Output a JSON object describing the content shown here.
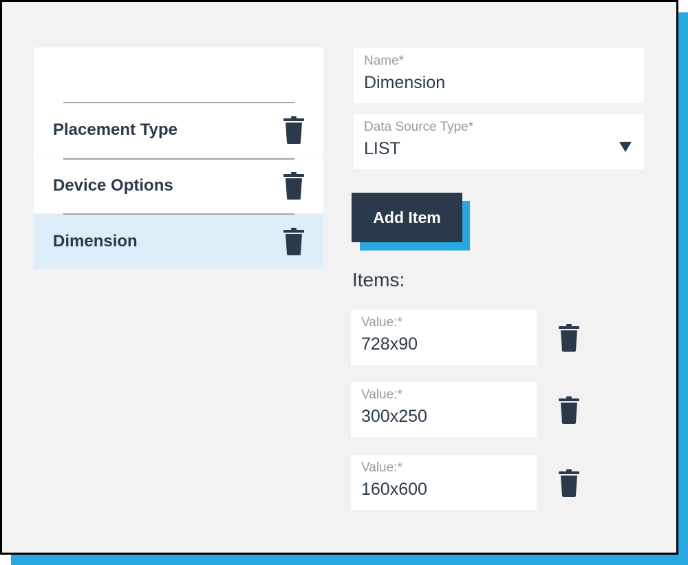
{
  "list": {
    "items": [
      {
        "label": "Placement Type",
        "selected": false
      },
      {
        "label": "Device Options",
        "selected": false
      },
      {
        "label": "Dimension",
        "selected": true
      }
    ]
  },
  "form": {
    "name": {
      "label": "Name*",
      "value": "Dimension"
    },
    "data_source_type": {
      "label": "Data Source Type*",
      "value": "LIST"
    },
    "add_item_label": "Add Item",
    "items_heading": "Items:",
    "items": [
      {
        "label": "Value:*",
        "value": "728x90"
      },
      {
        "label": "Value:*",
        "value": "300x250"
      },
      {
        "label": "Value:*",
        "value": "160x600"
      }
    ]
  },
  "colors": {
    "accent": "#29a8e0",
    "dark": "#2b3a4a",
    "selected_bg": "#ddeef8",
    "panel_bg": "#f2f2f2"
  },
  "icons": {
    "delete": "trash-icon",
    "dropdown": "caret-down-icon"
  }
}
